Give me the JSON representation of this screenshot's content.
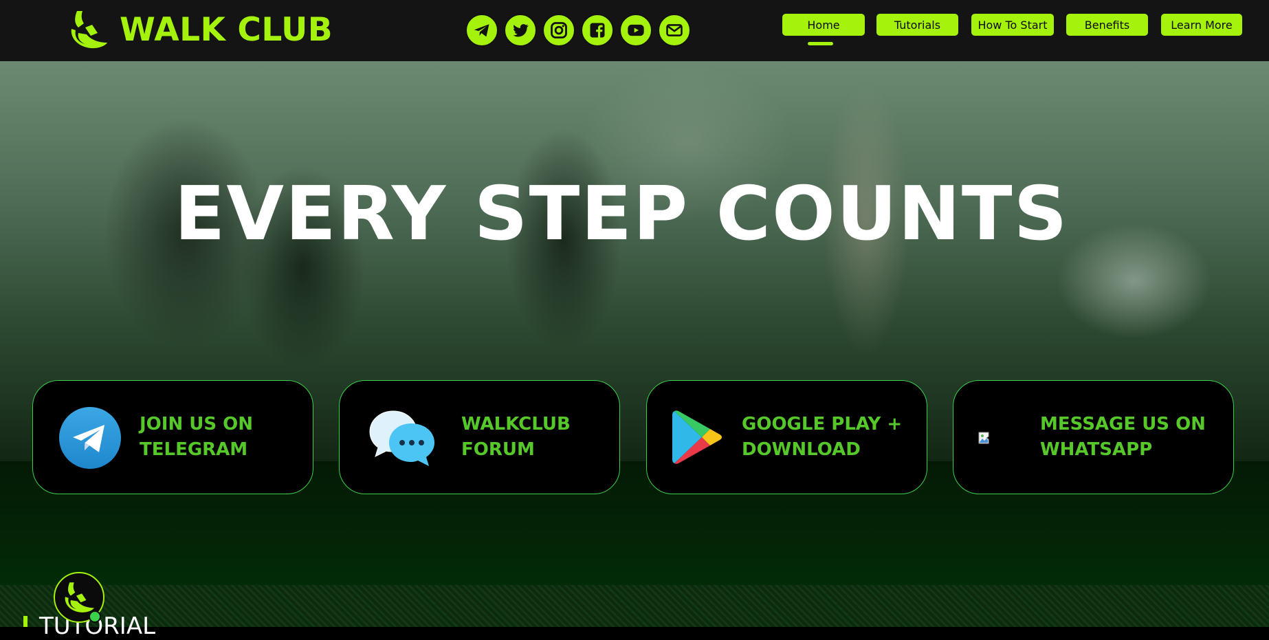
{
  "header": {
    "brand_name": "WALK CLUB",
    "socials": [
      {
        "icon": "telegram-icon"
      },
      {
        "icon": "twitter-icon"
      },
      {
        "icon": "instagram-icon"
      },
      {
        "icon": "facebook-icon"
      },
      {
        "icon": "youtube-icon"
      },
      {
        "icon": "email-icon"
      }
    ],
    "nav": {
      "items": [
        {
          "label": "Home",
          "active": true
        },
        {
          "label": "Tutorials"
        },
        {
          "label": "How To Start"
        },
        {
          "label": "Benefits"
        },
        {
          "label": "Learn More"
        }
      ]
    }
  },
  "hero": {
    "title": "EVERY STEP COUNTS"
  },
  "cards": [
    {
      "label": "JOIN US ON\nTELEGRAM",
      "icon": "telegram-icon"
    },
    {
      "label": "WALKCLUB\nFORUM",
      "icon": "chat-bubbles-icon"
    },
    {
      "label": "GOOGLE PLAY +\nDOWNLOAD",
      "icon": "google-play-icon"
    },
    {
      "label": "MESSAGE US ON\nWHATSAPP",
      "icon": "broken-image-icon"
    }
  ],
  "tutorial": {
    "title": "TUTORIAL"
  },
  "colors": {
    "accent": "#a5f20d",
    "card_text": "#56c82a",
    "card_border": "#3bd14a",
    "header_bg": "#141414"
  }
}
